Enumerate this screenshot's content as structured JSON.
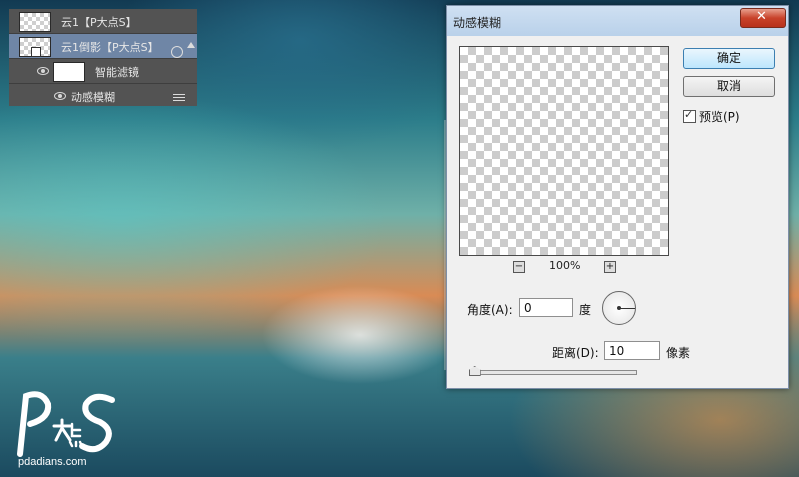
{
  "layers_panel": {
    "rows": [
      {
        "label": "云1【P大点S】"
      },
      {
        "label": "云1倒影【P大点S】",
        "selected": true
      },
      {
        "label": "智能滤镜"
      },
      {
        "label": "动感模糊"
      }
    ]
  },
  "dialog": {
    "title": "动感模糊",
    "close_symbol": "✕",
    "zoom": {
      "minus": "−",
      "value": "100%",
      "plus": "+"
    },
    "ok_label": "确定",
    "cancel_label": "取消",
    "preview": {
      "label": "预览(P)",
      "checked": true
    },
    "angle": {
      "label": "角度(A):",
      "value": "0",
      "unit": "度"
    },
    "distance": {
      "label": "距离(D):",
      "value": "10",
      "unit": "像素",
      "slider_fraction": 0.01
    }
  },
  "watermark": {
    "site": "pdadians.com",
    "logo_text": "PS大点"
  },
  "colors": {
    "selected_row": "#6f86a6",
    "panel_bg": "#535353",
    "close_red": "#c8422a",
    "primary_border": "#3c7fb1"
  }
}
